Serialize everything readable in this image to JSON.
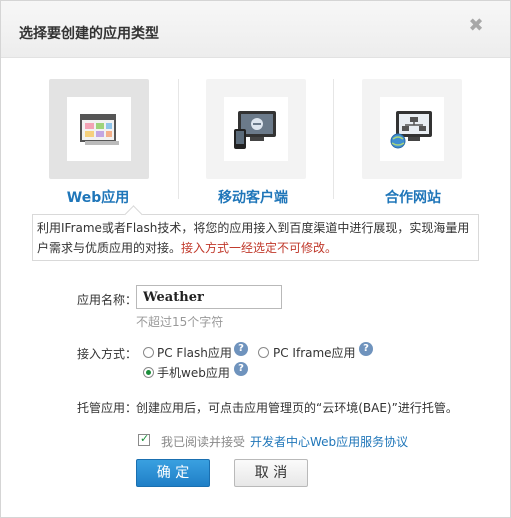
{
  "dialog": {
    "title": "选择要创建的应用类型",
    "close_glyph": "✖"
  },
  "types": [
    {
      "label": "Web应用",
      "icon": "browser-window-icon",
      "selected": true
    },
    {
      "label": "移动客户端",
      "icon": "mobile-client-icon",
      "selected": false
    },
    {
      "label": "合作网站",
      "icon": "partner-site-network-icon",
      "selected": false
    }
  ],
  "info": {
    "line1": "利用IFrame或者Flash技术，将您的应用接入到百度渠道中进行展现，实现海量用",
    "line2_normal": "户需求与优质应用的对接。",
    "line2_warn": "接入方式一经选定不可修改。"
  },
  "form": {
    "app_name_label": "应用名称：",
    "app_name_value": "Weather",
    "app_name_hint": "不超过15个字符",
    "access_label": "接入方式：",
    "access_options": [
      {
        "label": "PC Flash应用",
        "checked": false
      },
      {
        "label": "PC Iframe应用",
        "checked": false
      },
      {
        "label": "手机web应用",
        "checked": true
      }
    ],
    "hosting_label": "托管应用：",
    "hosting_text": "创建应用后，可点击应用管理页的“云环境(BAE)”进行托管。",
    "agree_text": "我已阅读并接受",
    "agree_link": "开发者中心Web应用服务协议",
    "help_glyph": "?"
  },
  "buttons": {
    "ok": "确 定",
    "cancel": "取 消"
  },
  "colors": {
    "accent": "#1f76b9",
    "warn": "#c0392b",
    "check": "#1a8e3a"
  }
}
